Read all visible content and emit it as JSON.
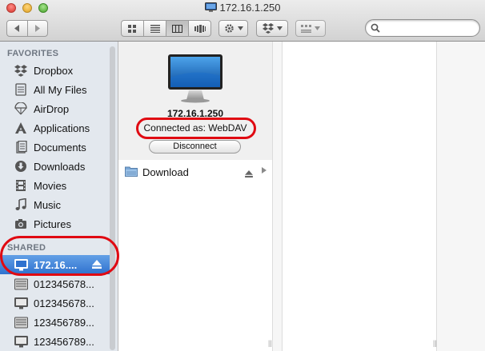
{
  "window": {
    "title": "172.16.1.250"
  },
  "toolbar": {
    "back_icon": "chevron-left-icon",
    "forward_icon": "chevron-right-icon",
    "view_modes": [
      "icon-view",
      "list-view",
      "column-view",
      "coverflow-view"
    ],
    "active_view": "column-view",
    "action_icon": "gear-icon",
    "dropbox_icon": "dropbox-icon",
    "arrange_icon": "arrange-icon",
    "search": {
      "placeholder": "",
      "value": ""
    }
  },
  "sidebar": {
    "favorites_header": "FAVORITES",
    "favorites": [
      {
        "label": "Dropbox",
        "icon": "dropbox-icon"
      },
      {
        "label": "All My Files",
        "icon": "all-files-icon"
      },
      {
        "label": "AirDrop",
        "icon": "airdrop-icon"
      },
      {
        "label": "Applications",
        "icon": "applications-icon"
      },
      {
        "label": "Documents",
        "icon": "documents-icon"
      },
      {
        "label": "Downloads",
        "icon": "downloads-icon"
      },
      {
        "label": "Movies",
        "icon": "movies-icon"
      },
      {
        "label": "Music",
        "icon": "music-icon"
      },
      {
        "label": "Pictures",
        "icon": "pictures-icon"
      }
    ],
    "shared_header": "SHARED",
    "shared": [
      {
        "label": "172.16....",
        "icon": "monitor-icon",
        "selected": true
      },
      {
        "label": "012345678...",
        "icon": "server-icon"
      },
      {
        "label": "012345678...",
        "icon": "monitor-icon"
      },
      {
        "label": "123456789...",
        "icon": "server-icon"
      },
      {
        "label": "123456789...",
        "icon": "monitor-icon"
      }
    ]
  },
  "server_panel": {
    "name": "172.16.1.250",
    "connected_as": "Connected as: WebDAV",
    "disconnect_label": "Disconnect"
  },
  "files": [
    {
      "name": "Download",
      "icon": "folder-icon"
    }
  ],
  "colors": {
    "selection": "#2f72cf",
    "annotation": "#e00a12",
    "sidebar_bg": "#e3e8ee"
  }
}
